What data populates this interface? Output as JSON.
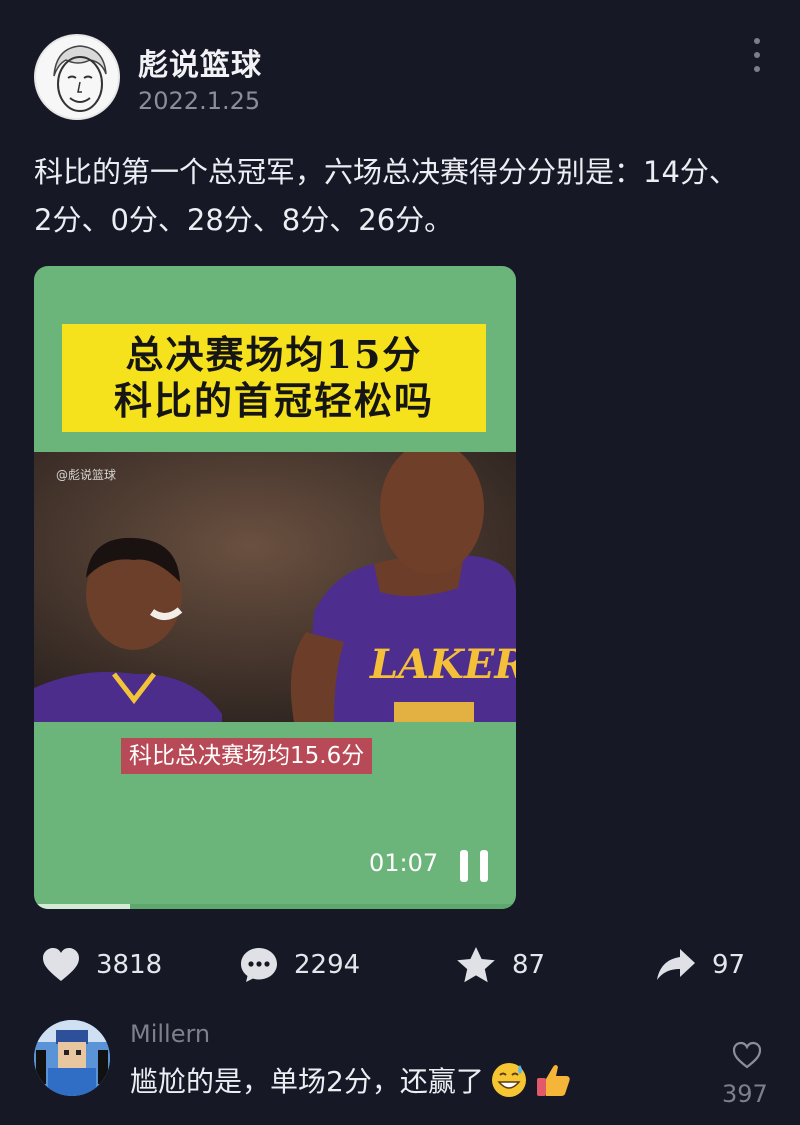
{
  "post": {
    "author": "彪说篮球",
    "date": "2022.1.25",
    "text": "科比的第一个总冠军，六场总决赛得分分别是：14分、2分、0分、28分、8分、26分。"
  },
  "video": {
    "title_line1": "总决赛场均15分",
    "title_line2": "科比的首冠轻松吗",
    "watermark": "@彪说篮球",
    "jersey_text": "LAKERS",
    "subtitle": "科比总决赛场均15.6分",
    "time": "01:07",
    "progress": 0.2,
    "background_color": "#6bb57a",
    "title_bg_color": "#f6e21c",
    "subtitle_bg_color": "#b84a57"
  },
  "actions": {
    "likes": "3818",
    "comments": "2294",
    "favorites": "87",
    "shares": "97"
  },
  "comment": {
    "user": "Millern",
    "text": "尴尬的是，单场2分，还赢了",
    "emojis": [
      "grinning-sweat-emoji",
      "thumbs-up-emoji"
    ],
    "likes": "397"
  },
  "icons": {
    "more": "more-vertical-icon",
    "like": "heart-icon",
    "comment": "comment-bubble-icon",
    "favorite": "star-icon",
    "share": "share-arrow-icon",
    "pause": "pause-icon"
  }
}
